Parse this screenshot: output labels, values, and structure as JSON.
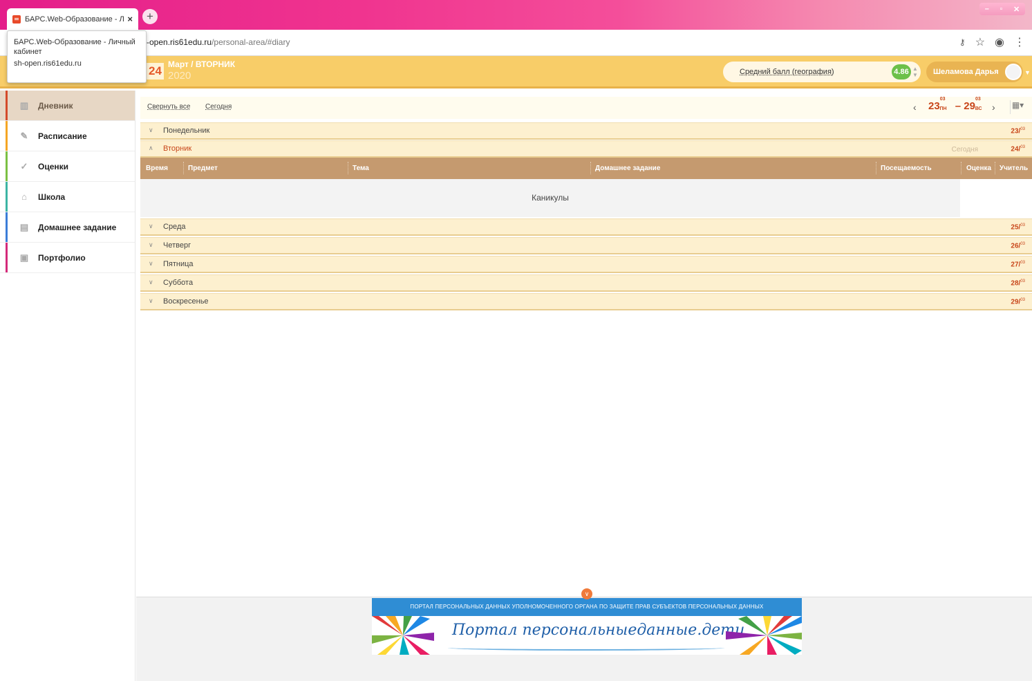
{
  "browser": {
    "tab_title": "БАРС.Web-Образование - Личн",
    "tab_close": "×",
    "new_tab": "+",
    "url_host": "-open.ris61edu.ru",
    "url_path": "/personal-area/#diary",
    "tooltip_title": "БАРС.Web-Образование - Личный кабинет",
    "tooltip_url": "sh-open.ris61edu.ru",
    "icons": [
      "key-icon",
      "star-icon",
      "account-icon",
      "menu-icon"
    ],
    "window_controls": [
      "minimize-icon",
      "maximize-icon",
      "close-icon"
    ]
  },
  "header": {
    "day": "24",
    "month_weekday": "Март / ВТОРНИК",
    "year": "2020",
    "avg_label": "Средний балл (география)",
    "avg_value": "4.86",
    "user_name": "Шеламова Дарья"
  },
  "sidebar": {
    "items": [
      {
        "label": "Дневник",
        "icon": "book-icon",
        "color": "#d44a2a"
      },
      {
        "label": "Расписание",
        "icon": "pen-icon",
        "color": "#f5a623"
      },
      {
        "label": "Оценки",
        "icon": "check-icon",
        "color": "#7bc043"
      },
      {
        "label": "Школа",
        "icon": "school-icon",
        "color": "#3cb4a4"
      },
      {
        "label": "Домашнее задание",
        "icon": "homework-icon",
        "color": "#3b7dd8"
      },
      {
        "label": "Портфолио",
        "icon": "portfolio-icon",
        "color": "#d42a7a"
      }
    ]
  },
  "toolbar": {
    "collapse_all": "Свернуть все",
    "today": "Сегодня",
    "week_start": "23",
    "week_start_month": "03",
    "week_start_dow": "ПН",
    "dash": "–",
    "week_end": "29",
    "week_end_month": "03",
    "week_end_dow": "ВС"
  },
  "days": [
    {
      "name": "Понедельник",
      "day": "23",
      "month": "03"
    },
    {
      "name": "Вторник",
      "day": "24",
      "month": "03",
      "today": "Сегодня"
    },
    {
      "name": "Среда",
      "day": "25",
      "month": "03"
    },
    {
      "name": "Четверг",
      "day": "26",
      "month": "03"
    },
    {
      "name": "Пятница",
      "day": "27",
      "month": "03"
    },
    {
      "name": "Суббота",
      "day": "28",
      "month": "03"
    },
    {
      "name": "Воскресенье",
      "day": "29",
      "month": "03"
    }
  ],
  "grid": {
    "columns": [
      "Время",
      "Предмет",
      "Тема",
      "Домашнее задание",
      "Посещаемость",
      "Оценка",
      "Учитель"
    ],
    "holiday": "Каникулы"
  },
  "footer": {
    "banner_top": "ПОРТАЛ ПЕРСОНАЛЬНЫХ ДАННЫХ УПОЛНОМОЧЕННОГО ОРГАНА ПО ЗАЩИТЕ ПРАВ СУБЪЕКТОВ ПЕРСОНАЛЬНЫХ ДАННЫХ",
    "banner_text": "Портал персональныеданные.дети"
  }
}
